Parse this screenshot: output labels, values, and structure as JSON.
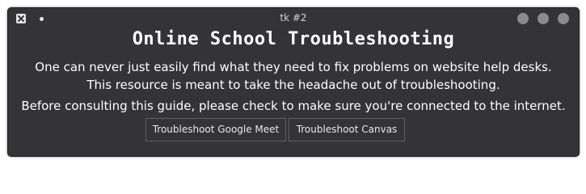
{
  "window": {
    "title": "tk #2"
  },
  "header": {
    "heading": "Online School Troubleshooting"
  },
  "body": {
    "lines": [
      "One can never just easily find what they need to fix problems on website help desks.",
      "This resource is meant to take the headache out of troubleshooting.",
      "Before consulting this guide, please check to make sure you're connected to the internet."
    ]
  },
  "buttons": {
    "meet_label": "Troubleshoot Google Meet",
    "canvas_label": "Troubleshoot Canvas"
  },
  "icons": {
    "app": "x-logo-icon",
    "pin": "pin-dot-icon",
    "minimize": "minimize-circle",
    "maximize": "maximize-circle",
    "close": "close-circle"
  },
  "colors": {
    "window_bg": "#333338",
    "text": "#ffffff",
    "button_border": "#5e5e64",
    "window_controls": "#8a8a8f"
  }
}
